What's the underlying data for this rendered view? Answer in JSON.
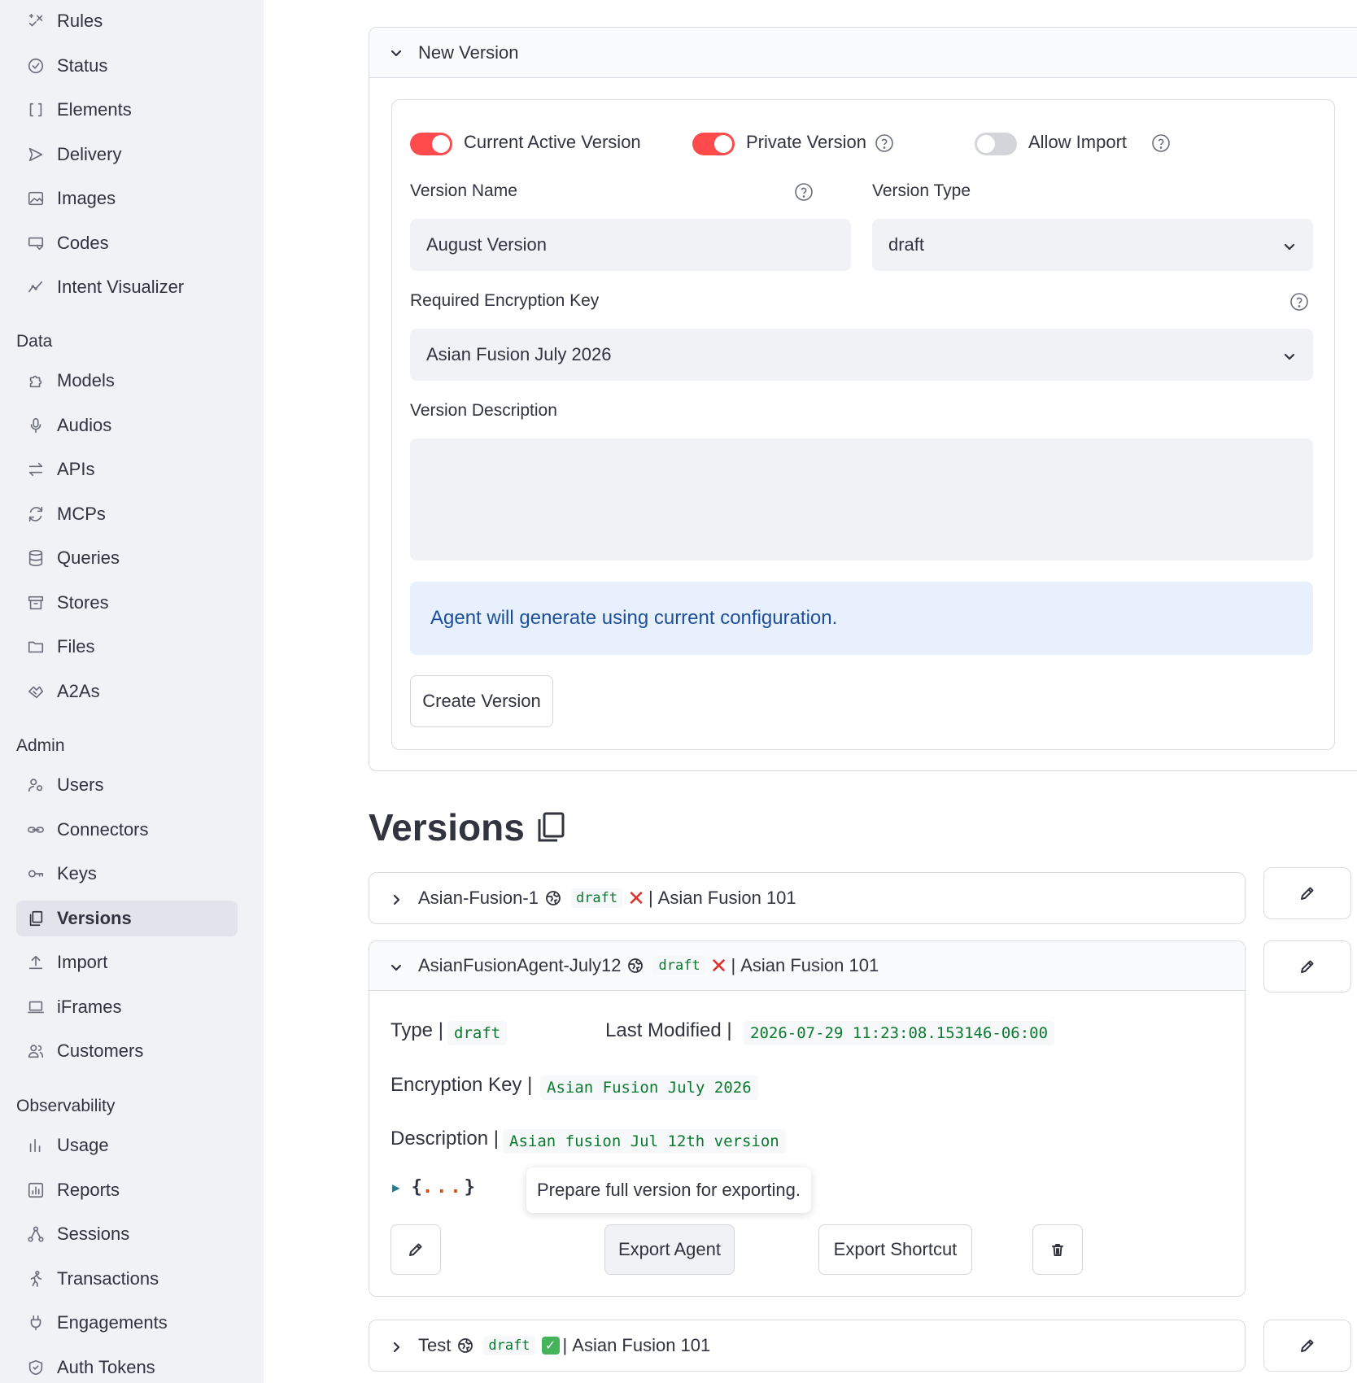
{
  "sidebar": {
    "top_items": [
      {
        "label": "Rules",
        "icon": "rules-icon"
      },
      {
        "label": "Status",
        "icon": "status-icon"
      },
      {
        "label": "Elements",
        "icon": "brackets-icon"
      },
      {
        "label": "Delivery",
        "icon": "send-icon"
      },
      {
        "label": "Images",
        "icon": "image-icon"
      },
      {
        "label": "Codes",
        "icon": "code-icon"
      },
      {
        "label": "Intent Visualizer",
        "icon": "chart-line-icon"
      }
    ],
    "sections": [
      {
        "title": "Data"
      },
      {
        "title": "Admin"
      },
      {
        "title": "Observability"
      }
    ],
    "data_items": [
      {
        "label": "Models",
        "icon": "puzzle-icon"
      },
      {
        "label": "Audios",
        "icon": "microphone-icon"
      },
      {
        "label": "APIs",
        "icon": "arrows-icon"
      },
      {
        "label": "MCPs",
        "icon": "refresh-icon"
      },
      {
        "label": "Queries",
        "icon": "database-icon"
      },
      {
        "label": "Stores",
        "icon": "archive-icon"
      },
      {
        "label": "Files",
        "icon": "folder-icon"
      },
      {
        "label": "A2As",
        "icon": "handshake-icon"
      }
    ],
    "admin_items": [
      {
        "label": "Users",
        "icon": "users-gear-icon"
      },
      {
        "label": "Connectors",
        "icon": "link-icon"
      },
      {
        "label": "Keys",
        "icon": "key-icon"
      },
      {
        "label": "Versions",
        "icon": "copy-icon",
        "active": true
      },
      {
        "label": "Import",
        "icon": "upload-icon"
      },
      {
        "label": "iFrames",
        "icon": "laptop-icon"
      },
      {
        "label": "Customers",
        "icon": "customers-icon"
      }
    ],
    "observability_items": [
      {
        "label": "Usage",
        "icon": "bar-chart-icon"
      },
      {
        "label": "Reports",
        "icon": "report-icon"
      },
      {
        "label": "Sessions",
        "icon": "network-icon"
      },
      {
        "label": "Transactions",
        "icon": "run-icon"
      },
      {
        "label": "Engagements",
        "icon": "plug-icon"
      },
      {
        "label": "Auth Tokens",
        "icon": "shield-icon"
      }
    ]
  },
  "new_version": {
    "title": "New Version",
    "toggles": {
      "current_active": {
        "label": "Current Active Version",
        "on": true
      },
      "private": {
        "label": "Private Version",
        "on": true
      },
      "allow_import": {
        "label": "Allow Import",
        "on": false
      }
    },
    "version_name_label": "Version Name",
    "version_name_value": "August Version",
    "version_type_label": "Version Type",
    "version_type_value": "draft",
    "encryption_label": "Required Encryption Key",
    "encryption_value": "Asian Fusion July 2026",
    "description_label": "Version Description",
    "description_value": "",
    "info_text": "Agent will generate using current configuration.",
    "create_button": "Create Version"
  },
  "versions": {
    "heading": "Versions",
    "rows": [
      {
        "name": "Asian-Fusion-1",
        "type": "draft",
        "status": "x",
        "separator": "|",
        "agent": "Asian Fusion 101",
        "expanded": false
      },
      {
        "name": "AsianFusionAgent-July12",
        "type": "draft",
        "status": "x",
        "separator": "|",
        "agent": "Asian Fusion 101",
        "expanded": true
      },
      {
        "name": "Test",
        "type": "draft",
        "status": "check",
        "separator": "|",
        "agent": "Asian Fusion 101",
        "expanded": false
      }
    ],
    "detail": {
      "type_label": "Type |",
      "type_value": "draft",
      "modified_label": "Last Modified |",
      "modified_value": "2026-07-29 11:23:08.153146-06:00",
      "key_label": "Encryption Key |",
      "key_value": "Asian Fusion July 2026",
      "desc_label": "Description |",
      "desc_value": "Asian fusion Jul 12th version",
      "json_open": "{",
      "json_dots": "...",
      "json_close": "}",
      "tooltip": "Prepare full version for exporting.",
      "export_agent": "Export Agent",
      "export_shortcut": "Export Shortcut"
    }
  }
}
